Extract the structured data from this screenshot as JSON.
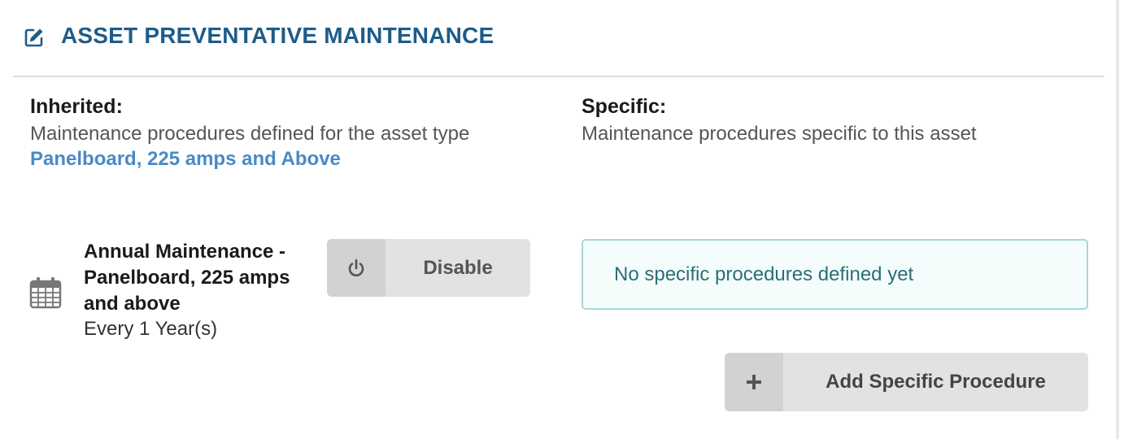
{
  "header": {
    "title": "ASSET PREVENTATIVE MAINTENANCE",
    "icon": "edit-icon",
    "color": "#1d5c8a"
  },
  "inherited": {
    "title": "Inherited:",
    "description": "Maintenance procedures defined for the asset type",
    "asset_type_link": "Panelboard, 225 amps and Above",
    "procedures": [
      {
        "icon": "calendar-icon",
        "name": "Annual Maintenance - Panelboard, 225 amps and above",
        "frequency": "Every 1 Year(s)",
        "action_label": "Disable",
        "action_icon": "power-icon"
      }
    ]
  },
  "specific": {
    "title": "Specific:",
    "description": "Maintenance procedures specific to this asset",
    "empty_message": "No specific procedures defined yet",
    "add_button_label": "Add Specific Procedure",
    "add_button_icon": "plus-icon"
  }
}
